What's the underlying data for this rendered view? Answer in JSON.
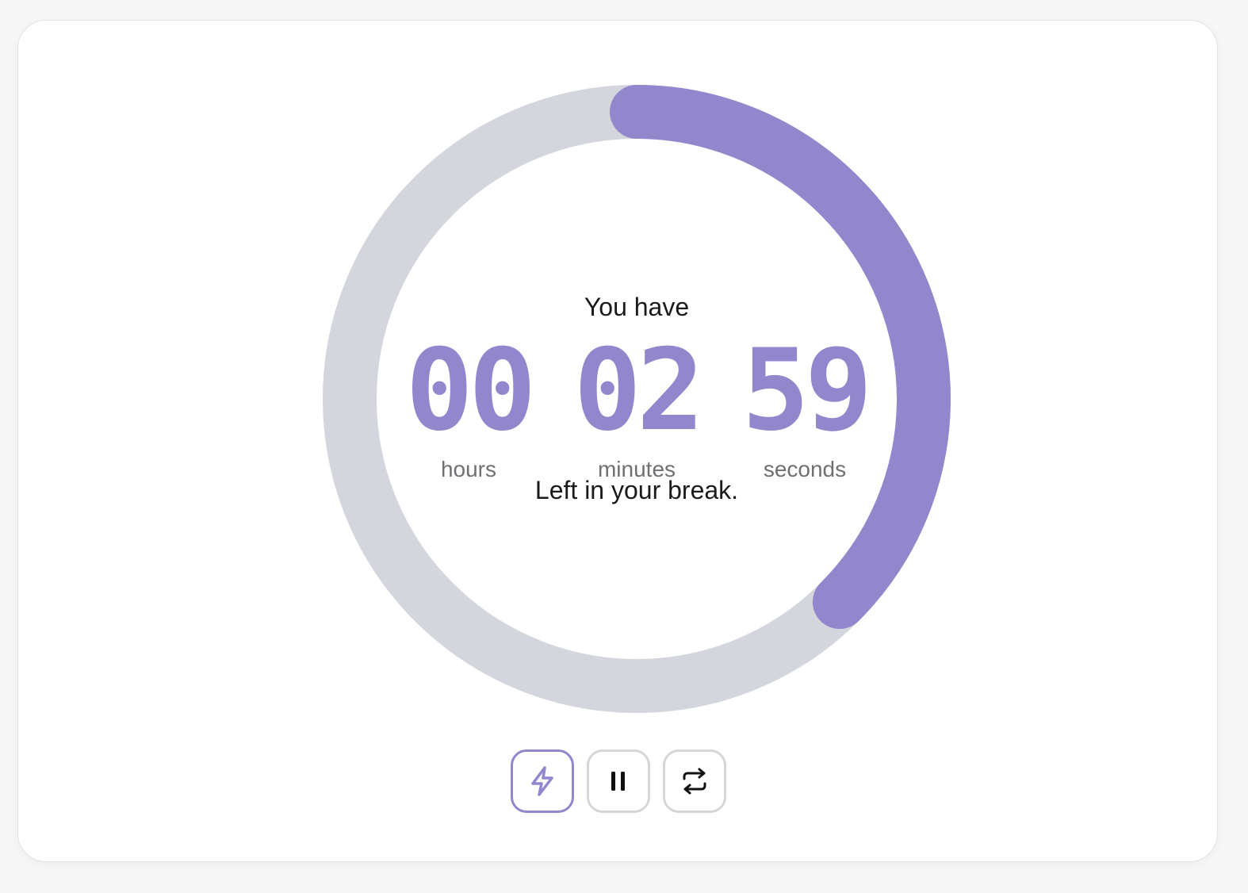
{
  "timer": {
    "intro": "You have",
    "outro": "Left in your break.",
    "progress_fraction": 0.375,
    "hours": {
      "value": "00",
      "label": "hours"
    },
    "minutes": {
      "value": "02",
      "label": "minutes"
    },
    "seconds": {
      "value": "59",
      "label": "seconds"
    }
  },
  "controls": [
    {
      "name": "lightning-button",
      "icon": "lightning-icon",
      "active": true
    },
    {
      "name": "pause-button",
      "icon": "pause-icon",
      "active": false
    },
    {
      "name": "reset-button",
      "icon": "refresh-icon",
      "active": false
    }
  ],
  "colors": {
    "accent": "#9287cd",
    "track": "#d3d6dc",
    "text": "#1a1a1a",
    "muted": "#6f6f74"
  }
}
